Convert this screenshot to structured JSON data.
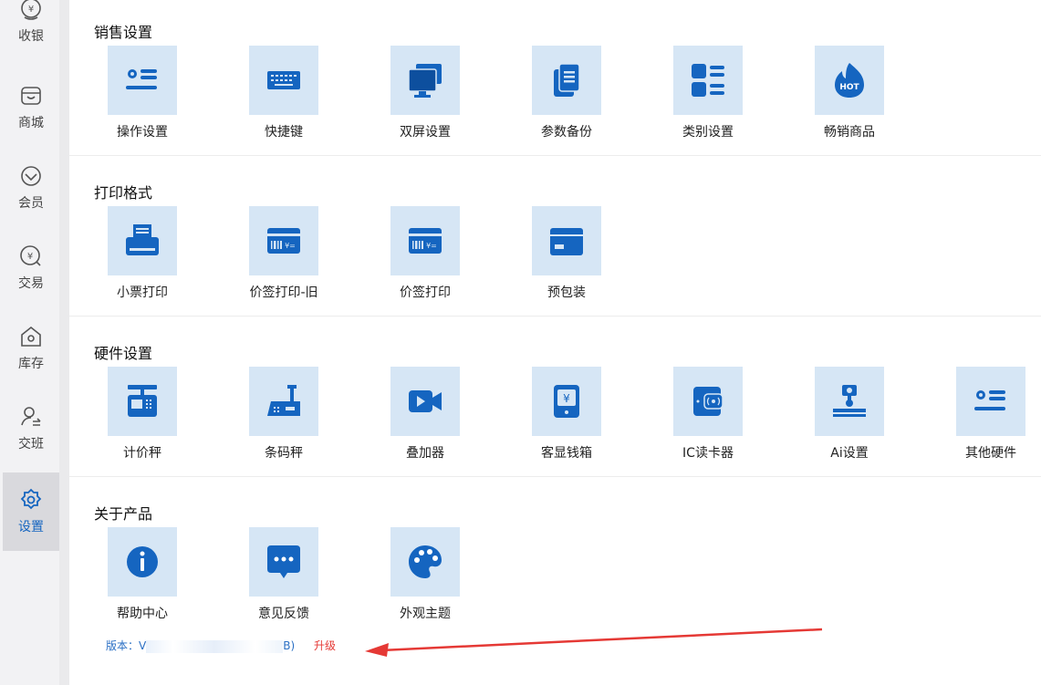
{
  "sidebar": {
    "items": [
      {
        "label": "收银",
        "icon": "cashier-icon"
      },
      {
        "label": "商城",
        "icon": "store-icon"
      },
      {
        "label": "会员",
        "icon": "member-icon"
      },
      {
        "label": "交易",
        "icon": "transaction-icon"
      },
      {
        "label": "库存",
        "icon": "inventory-icon"
      },
      {
        "label": "交班",
        "icon": "shift-handover-icon"
      },
      {
        "label": "设置",
        "icon": "settings-icon",
        "active": true
      }
    ]
  },
  "sections": [
    {
      "title": "销售设置",
      "tiles": [
        {
          "label": "操作设置",
          "icon": "operation-settings-icon"
        },
        {
          "label": "快捷键",
          "icon": "keyboard-icon"
        },
        {
          "label": "双屏设置",
          "icon": "dual-screen-icon"
        },
        {
          "label": "参数备份",
          "icon": "backup-icon"
        },
        {
          "label": "类别设置",
          "icon": "category-icon"
        },
        {
          "label": "畅销商品",
          "icon": "hot-icon",
          "badge": "HOT"
        }
      ]
    },
    {
      "title": "打印格式",
      "tiles": [
        {
          "label": "小票打印",
          "icon": "receipt-printer-icon"
        },
        {
          "label": "价签打印-旧",
          "icon": "price-tag-icon"
        },
        {
          "label": "价签打印",
          "icon": "price-tag-icon"
        },
        {
          "label": "预包装",
          "icon": "package-icon"
        }
      ]
    },
    {
      "title": "硬件设置",
      "tiles": [
        {
          "label": "计价秤",
          "icon": "pricing-scale-icon"
        },
        {
          "label": "条码秤",
          "icon": "barcode-scale-icon"
        },
        {
          "label": "叠加器",
          "icon": "video-overlay-icon"
        },
        {
          "label": "客显钱箱",
          "icon": "cash-drawer-icon"
        },
        {
          "label": "IC读卡器",
          "icon": "card-reader-icon"
        },
        {
          "label": "Ai设置",
          "icon": "ai-scale-icon"
        },
        {
          "label": "其他硬件",
          "icon": "other-hardware-icon"
        }
      ]
    },
    {
      "title": "关于产品",
      "tiles": [
        {
          "label": "帮助中心",
          "icon": "info-icon"
        },
        {
          "label": "意见反馈",
          "icon": "feedback-icon"
        },
        {
          "label": "外观主题",
          "icon": "palette-icon"
        }
      ]
    }
  ],
  "footer": {
    "version_label": "版本：V",
    "version_suffix": "B)",
    "upgrade_label": "升级"
  },
  "colors": {
    "accent": "#1565c0",
    "tile_bg": "#d6e6f5",
    "upgrade": "#e53935",
    "arrow": "#e53935"
  }
}
